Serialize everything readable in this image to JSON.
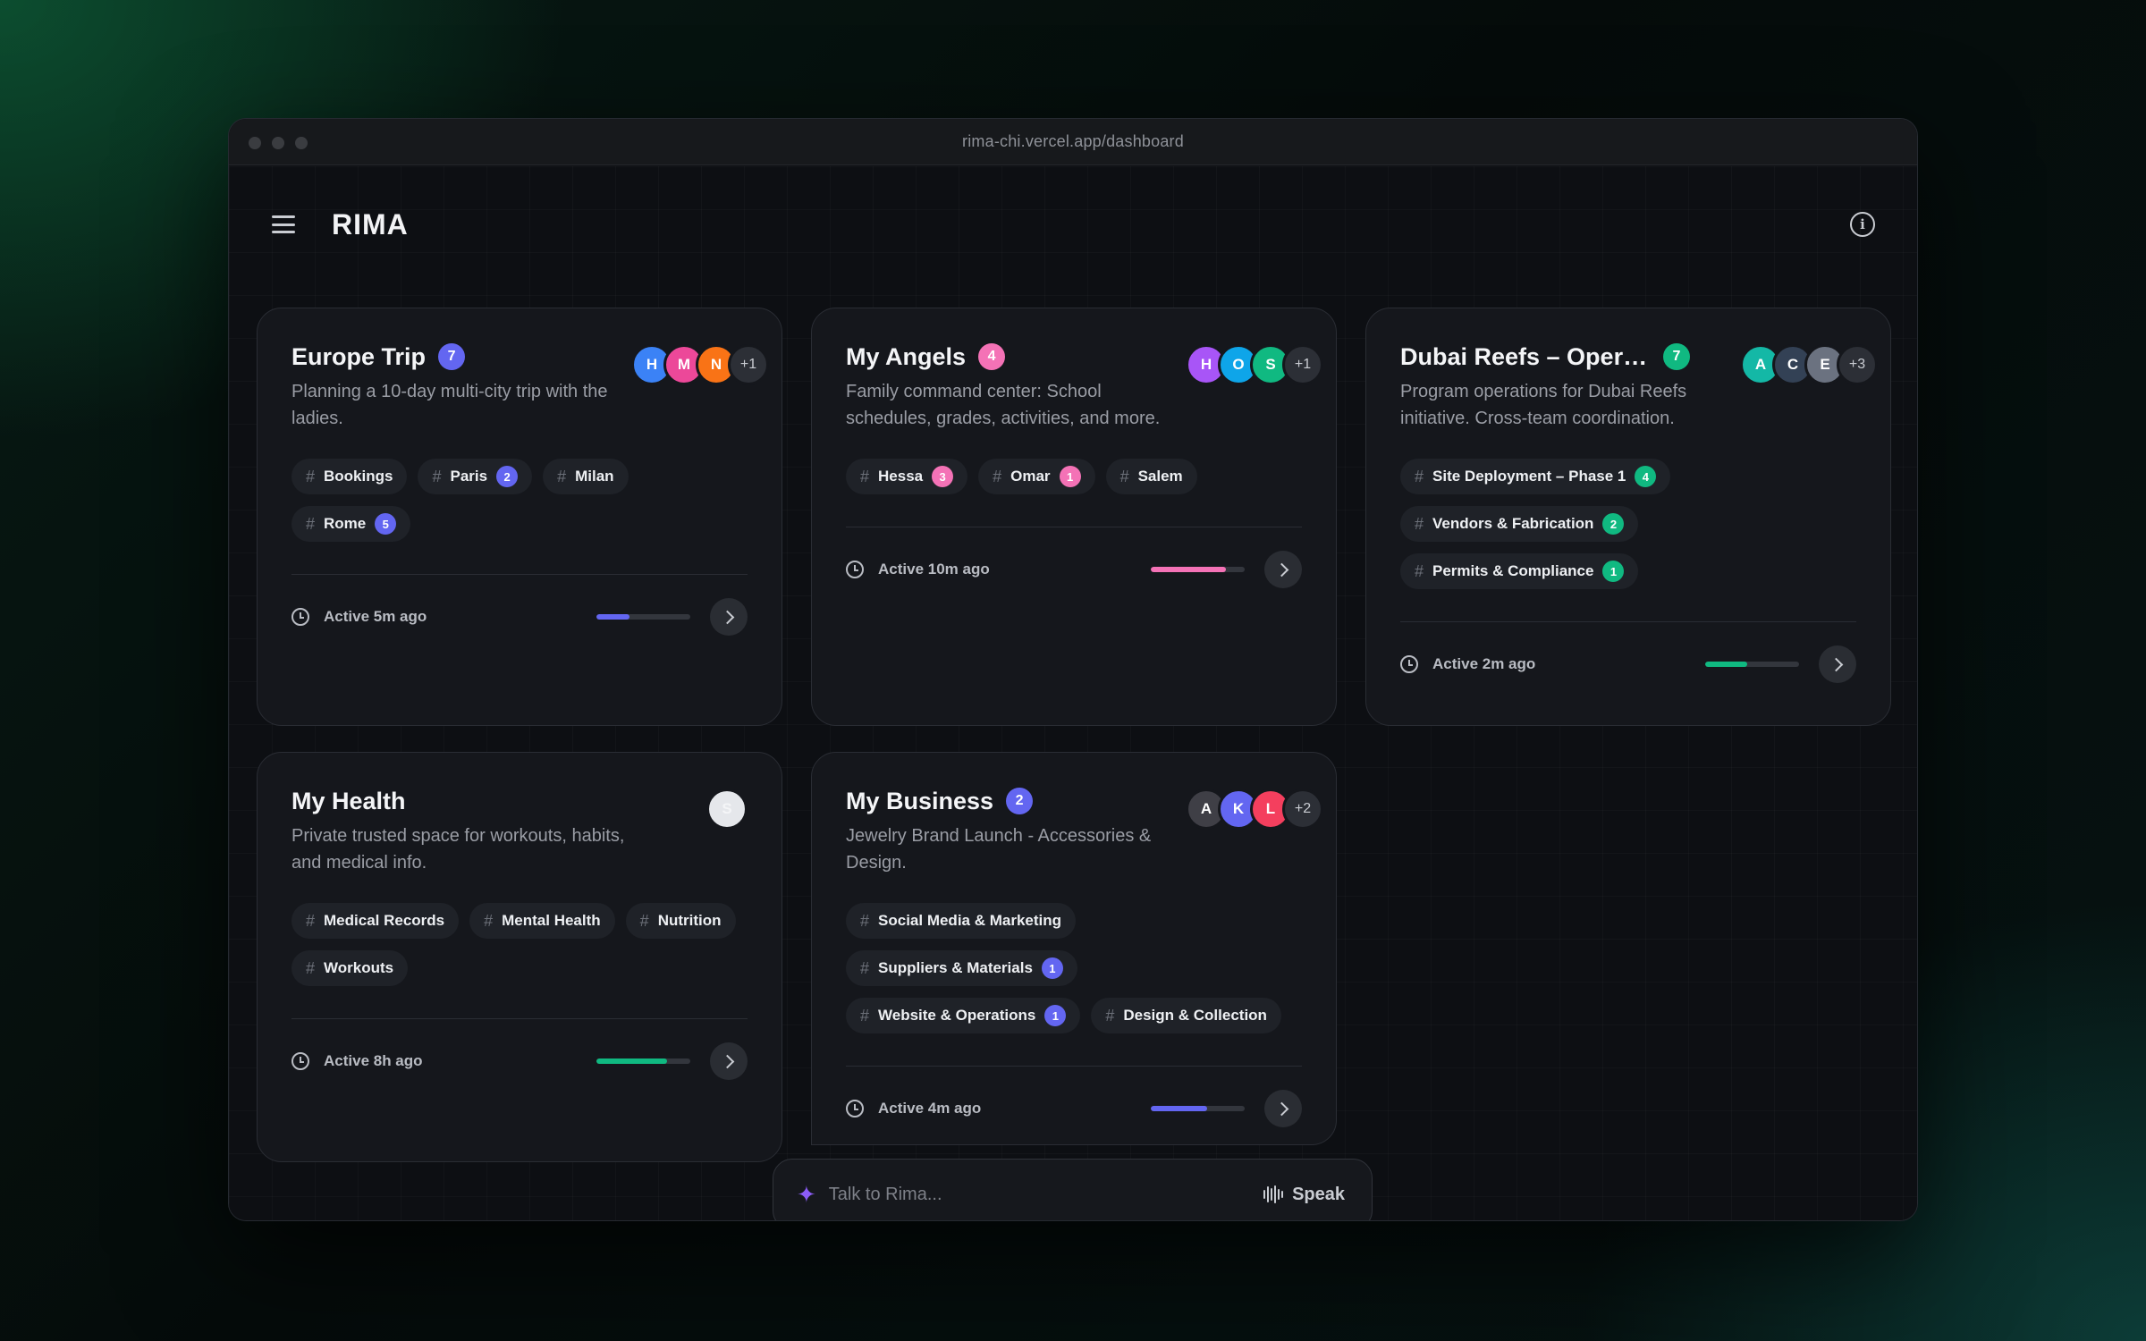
{
  "browser": {
    "url": "rima-chi.vercel.app/dashboard"
  },
  "app": {
    "logo": "RIMA"
  },
  "colors": {
    "blue": "#3b82f6",
    "pink": "#ec4899",
    "orange": "#f97316",
    "purple": "#a855f7",
    "sky": "#0ea5e9",
    "green": "#10b981",
    "teal": "#14b8a6",
    "slate": "#334155",
    "gray": "#6b7280",
    "indigo": "#6366f1",
    "rose": "#f43f5e",
    "light": "#e5e7eb"
  },
  "cards": [
    {
      "title": "Europe Trip",
      "count": "7",
      "count_color": "#6366f1",
      "description": "Planning a 10-day multi-city trip with the ladies.",
      "avatars": [
        {
          "letter": "H",
          "color": "#3b82f6"
        },
        {
          "letter": "M",
          "color": "#ec4899"
        },
        {
          "letter": "N",
          "color": "#f97316"
        }
      ],
      "more": "+1",
      "tags": [
        {
          "label": "Bookings",
          "count": "",
          "color": ""
        },
        {
          "label": "Paris",
          "count": "2",
          "color": "#6366f1"
        },
        {
          "label": "Milan",
          "count": "",
          "color": ""
        },
        {
          "label": "Rome",
          "count": "5",
          "color": "#6366f1"
        }
      ],
      "active": "Active 5m ago",
      "progress": 0.35,
      "progress_color": "#6366f1"
    },
    {
      "title": "My Angels",
      "count": "4",
      "count_color": "#f472b6",
      "description": "Family command center: School schedules, grades, activities, and more.",
      "avatars": [
        {
          "letter": "H",
          "color": "#a855f7"
        },
        {
          "letter": "O",
          "color": "#0ea5e9"
        },
        {
          "letter": "S",
          "color": "#10b981"
        }
      ],
      "more": "+1",
      "tags": [
        {
          "label": "Hessa",
          "count": "3",
          "color": "#f472b6"
        },
        {
          "label": "Omar",
          "count": "1",
          "color": "#f472b6"
        },
        {
          "label": "Salem",
          "count": "",
          "color": ""
        }
      ],
      "active": "Active 10m ago",
      "progress": 0.8,
      "progress_color": "#f472b6"
    },
    {
      "title": "Dubai Reefs – Operations",
      "count": "7",
      "count_color": "#10b981",
      "description": "Program operations for Dubai Reefs initiative. Cross-team coordination.",
      "avatars": [
        {
          "letter": "A",
          "color": "#14b8a6"
        },
        {
          "letter": "C",
          "color": "#334155"
        },
        {
          "letter": "E",
          "color": "#6b7280"
        }
      ],
      "more": "+3",
      "tags": [
        {
          "label": "Site Deployment – Phase 1",
          "count": "4",
          "color": "#10b981"
        },
        {
          "label": "Vendors & Fabrication",
          "count": "2",
          "color": "#10b981"
        },
        {
          "label": "Permits & Compliance",
          "count": "1",
          "color": "#10b981"
        }
      ],
      "active": "Active 2m ago",
      "progress": 0.45,
      "progress_color": "#10b981"
    },
    {
      "title": "My Health",
      "count": "",
      "count_color": "",
      "description": "Private trusted space for workouts, habits, and medical info.",
      "avatars": [
        {
          "letter": "S",
          "color": "#e5e7eb"
        }
      ],
      "more": "",
      "tags": [
        {
          "label": "Medical Records",
          "count": "",
          "color": ""
        },
        {
          "label": "Mental Health",
          "count": "",
          "color": ""
        },
        {
          "label": "Nutrition",
          "count": "",
          "color": ""
        },
        {
          "label": "Workouts",
          "count": "",
          "color": ""
        }
      ],
      "active": "Active 8h ago",
      "progress": 0.75,
      "progress_color": "#10b981"
    },
    {
      "title": "My Business",
      "count": "2",
      "count_color": "#6366f1",
      "description": "Jewelry Brand Launch - Accessories & Design.",
      "avatars": [
        {
          "letter": "A",
          "color": "#3f3f46"
        },
        {
          "letter": "K",
          "color": "#6366f1"
        },
        {
          "letter": "L",
          "color": "#f43f5e"
        }
      ],
      "more": "+2",
      "tags": [
        {
          "label": "Social Media & Marketing",
          "count": "",
          "color": ""
        },
        {
          "label": "Suppliers & Materials",
          "count": "1",
          "color": "#6366f1"
        },
        {
          "label": "Website & Operations",
          "count": "1",
          "color": "#6366f1"
        },
        {
          "label": "Design & Collection",
          "count": "",
          "color": ""
        }
      ],
      "active": "Active 4m ago",
      "progress": 0.6,
      "progress_color": "#6366f1"
    }
  ],
  "talk": {
    "placeholder": "Talk to Rima...",
    "speak_label": "Speak"
  }
}
